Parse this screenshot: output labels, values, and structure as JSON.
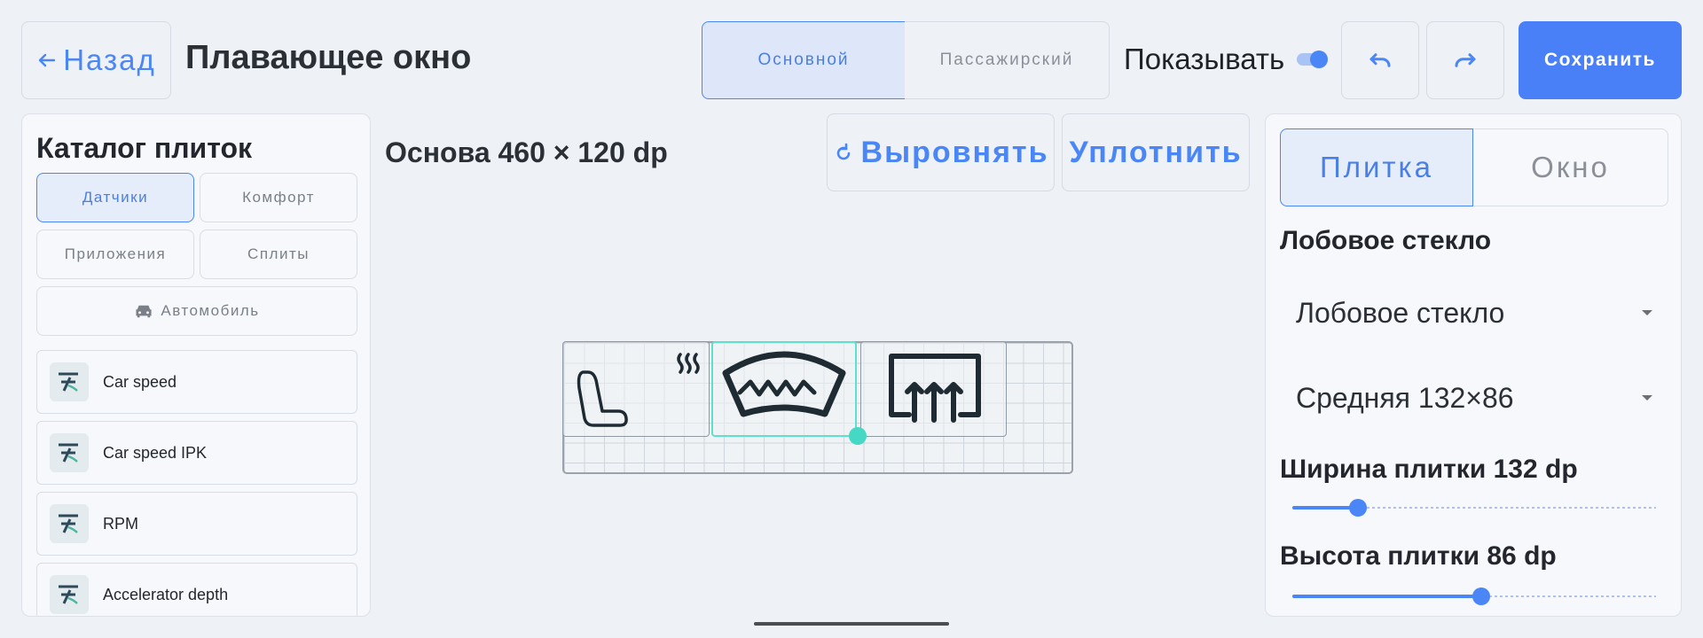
{
  "header": {
    "back_label": "Назад",
    "title": "Плавающее окно",
    "segments": [
      "Основной",
      "Пассажирский"
    ],
    "active_segment": "Основной",
    "show_label": "Показывать",
    "show_enabled": true,
    "save_label": "Сохранить"
  },
  "catalog": {
    "title": "Каталог плиток",
    "categories": [
      "Датчики",
      "Комфорт",
      "Приложения",
      "Сплиты",
      "Автомобиль"
    ],
    "active_category": "Датчики",
    "items": [
      "Car speed",
      "Car speed IPK",
      "RPM",
      "Accelerator depth"
    ]
  },
  "canvas": {
    "title": "Основа 460 × 120 dp",
    "align_label": "Выровнять",
    "compact_label": "Уплотнить",
    "tiles": [
      "seat-heating-icon",
      "windshield-defrost-icon",
      "rear-window-defrost-icon"
    ]
  },
  "properties": {
    "tabs": [
      "Плитка",
      "Окно"
    ],
    "active_tab": "Плитка",
    "tile_name": "Лобовое стекло",
    "tile_select": "Лобовое стекло",
    "size_select": "Средняя 132×86",
    "width_label": "Ширина плитки 132 dp",
    "width_fraction": 0.18,
    "height_label": "Высота плитки 86 dp",
    "height_fraction": 0.52
  },
  "colors": {
    "accent": "#4a86f5",
    "selection": "#5ee0cd"
  }
}
